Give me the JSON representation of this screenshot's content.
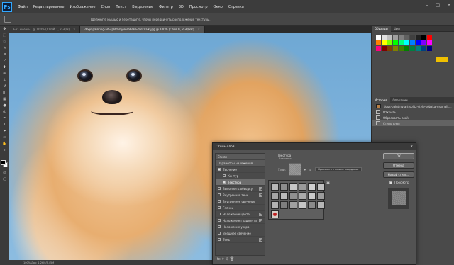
{
  "app": {
    "logo": "Ps"
  },
  "menu": [
    "Файл",
    "Редактирование",
    "Изображение",
    "Слои",
    "Текст",
    "Выделение",
    "Фильтр",
    "3D",
    "Просмотр",
    "Окно",
    "Справка"
  ],
  "options_bar": {
    "hint": "Щелкните мышью и перетащите, чтобы передвинуть расположение текстуры."
  },
  "tabs": [
    {
      "label": "Без имени-1 @ 100% (СЛОЙ 1, RGB/8)",
      "active": false
    },
    {
      "label": "dogs-painting-art-splitz-style-sobaka-moxnaik.jpg @ 100% (Слой 0, RGB/8#)",
      "active": true
    }
  ],
  "statusbar": {
    "text": "100%   Док: 1,26М/5,45М"
  },
  "swatches": {
    "tabs": [
      "Образцы",
      "Цвет"
    ],
    "colors": [
      "#ffffff",
      "#e0e0e0",
      "#bfbfbf",
      "#9f9f9f",
      "#7f7f7f",
      "#606060",
      "#404040",
      "#202020",
      "#000000",
      "#ff0000",
      "#ff7f00",
      "#ffff00",
      "#7fff00",
      "#00ff00",
      "#00ff7f",
      "#00ffff",
      "#007fff",
      "#0000ff",
      "#7f00ff",
      "#ff00ff",
      "#ff007f",
      "#800000",
      "#804000",
      "#808000",
      "#408000",
      "#008000",
      "#008040",
      "#008080",
      "#004080",
      "#000080"
    ],
    "highlight_color": "#f0c000"
  },
  "history": {
    "tabs": [
      "История",
      "Операции"
    ],
    "file": "dogs-painting-art-splitz-style-sobaka-moxnaik.jpg",
    "items": [
      {
        "label": "Открыть",
        "selected": false
      },
      {
        "label": "Образовать слой",
        "selected": false
      },
      {
        "label": "Стиль слоя",
        "selected": true
      }
    ]
  },
  "dialog": {
    "title": "Стиль слоя",
    "left_list": [
      {
        "label": "Стили",
        "type": "head"
      },
      {
        "label": "Параметры наложения",
        "type": "head"
      },
      {
        "label": "Тиснение",
        "type": "check",
        "checked": true,
        "plus": false,
        "selected": false,
        "indent": false
      },
      {
        "label": "Контур",
        "type": "check",
        "checked": false,
        "plus": false,
        "selected": false,
        "indent": true
      },
      {
        "label": "Текстура",
        "type": "check",
        "checked": true,
        "plus": false,
        "selected": true,
        "indent": true
      },
      {
        "label": "Выполнить обводку",
        "type": "check",
        "checked": false,
        "plus": true,
        "selected": false,
        "indent": false
      },
      {
        "label": "Внутренняя тень",
        "type": "check",
        "checked": false,
        "plus": true,
        "selected": false,
        "indent": false
      },
      {
        "label": "Внутреннее свечение",
        "type": "check",
        "checked": false,
        "plus": false,
        "selected": false,
        "indent": false
      },
      {
        "label": "Глянец",
        "type": "check",
        "checked": false,
        "plus": false,
        "selected": false,
        "indent": false
      },
      {
        "label": "Наложение цвета",
        "type": "check",
        "checked": false,
        "plus": true,
        "selected": false,
        "indent": false
      },
      {
        "label": "Наложение градиента",
        "type": "check",
        "checked": false,
        "plus": true,
        "selected": false,
        "indent": false
      },
      {
        "label": "Наложение узора",
        "type": "check",
        "checked": false,
        "plus": false,
        "selected": false,
        "indent": false
      },
      {
        "label": "Внешнее свечение",
        "type": "check",
        "checked": false,
        "plus": false,
        "selected": false,
        "indent": false
      },
      {
        "label": "Тень",
        "type": "check",
        "checked": false,
        "plus": true,
        "selected": false,
        "indent": false
      }
    ],
    "bottom_icons": "fx  ⇧  ⇩  🗑",
    "group_title": "Текстура",
    "group_sub": "Элементы",
    "pattern_label": "Узор:",
    "snap_button": "Привязать к началу координат",
    "pattern_colors": [
      "#b8b8b8",
      "#8d8d8d",
      "#c8c8c8",
      "#9a9a9a",
      "#d0d0d0",
      "#c0c0c0",
      "#a5a5a5",
      "#bdbdbd",
      "#909090",
      "#aaaaaa",
      "#cacaca",
      "#9c9c9c",
      "#b2b2b2",
      "#7e7e7e",
      "#a0a0a0",
      "#c5c5c5",
      "#8a8a8a",
      "#b6b6b6",
      "#d6d0c8"
    ],
    "buttons": {
      "ok": "OK",
      "cancel": "Отмена",
      "new_style": "Новый стиль..."
    },
    "preview_label": "Просмотр"
  }
}
